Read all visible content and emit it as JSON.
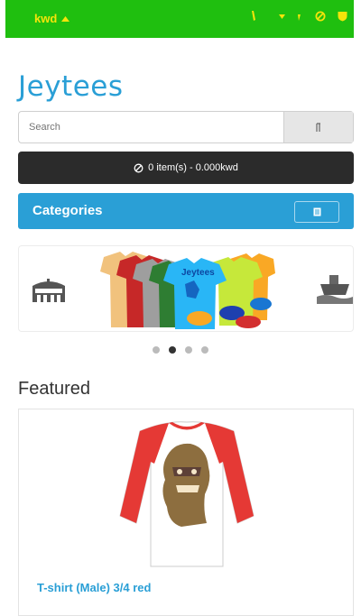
{
  "topbar": {
    "currency": "kwd",
    "icons": [
      "caret-up-icon",
      "phone-icon",
      "caret-down-icon",
      "comma-icon",
      "ban-icon",
      "shield-icon"
    ]
  },
  "brand": {
    "logo": "Jeytees"
  },
  "search": {
    "placeholder": "Search",
    "button_icon": "search-icon"
  },
  "cart": {
    "text": "0 item(s) - 0.000kwd",
    "icon": "cart-icon"
  },
  "categories": {
    "label": "Categories",
    "button_icon": "menu-icon"
  },
  "slider": {
    "slides": [
      "stadium-icon",
      "tshirts-and-caps-banner",
      "ship-icon"
    ],
    "banner_text": "Jeytees",
    "dots": 4,
    "active_dot": 1
  },
  "featured": {
    "title": "Featured",
    "products": [
      {
        "name": "T-shirt (Male) 3/4 red"
      }
    ]
  },
  "colors": {
    "topbar": "#1fbf0f",
    "topbar_text": "#f4e40a",
    "accent": "#2a9fd6",
    "cart_bg": "#2b2b2b"
  }
}
